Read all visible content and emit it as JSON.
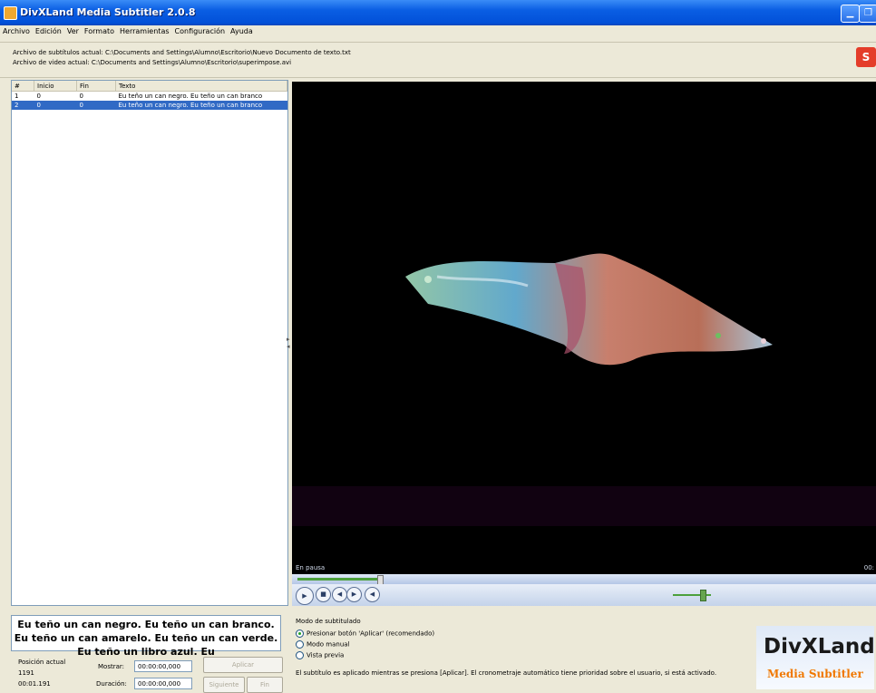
{
  "window": {
    "title": "DivXLand Media Subtitler 2.0.8"
  },
  "menu": [
    "Archivo",
    "Edición",
    "Ver",
    "Formato",
    "Herramientas",
    "Configuración",
    "Ayuda"
  ],
  "info": {
    "subtitle_file": "Archivo de subtítulos actual: C:\\Documents and Settings\\Alumno\\Escritorio\\Nuevo Documento de texto.txt",
    "video_file": "Archivo de video actual:  C:\\Documents and Settings\\Alumno\\Escritorio\\superimpose.avi",
    "logo_letter": "S"
  },
  "subtitle_list": {
    "headers": [
      "#",
      "Inicio",
      "Fin",
      "Texto"
    ],
    "rows": [
      {
        "num": "1",
        "start": "0",
        "end": "0",
        "text": "Eu teño un can negro. Eu teño un can branco"
      },
      {
        "num": "2",
        "start": "0",
        "end": "0",
        "text": "Eu teño un can negro. Eu teño un can branco"
      }
    ]
  },
  "player": {
    "status": "En pausa",
    "time": "00:",
    "seek_progress": 0.15,
    "volume_level": 0.6
  },
  "current_subtitle": "Eu teño un can negro. Eu teño un can branco. Eu teño un can amarelo. Eu teño un can verde. Eu teño un libro azul. Eu",
  "position": {
    "label": "Posición actual",
    "frame": "1191",
    "time": "00:01.191",
    "show_label": "Mostrar:",
    "show_value": "00:00:00,000",
    "duration_label": "Duración:",
    "duration_value": "00:00:00,000"
  },
  "buttons": {
    "apply": "Aplicar",
    "next": "Siguiente",
    "end": "Fin"
  },
  "mode": {
    "title": "Modo de subtitulado",
    "options": [
      "Presionar botón 'Aplicar' (recomendado)",
      "Modo manual",
      "Vista previa"
    ],
    "selected": 0,
    "note": "El subtítulo es aplicado mientras se presiona [Aplicar]. El cronometraje automático tiene prioridad sobre el usuario, si está activado."
  },
  "brand": {
    "line1": "DivXLand",
    "line2": "Media Subtitler"
  },
  "colors": {
    "titlebar": "#0a5ee3",
    "selection": "#316ac5",
    "brand_orange": "#f07800",
    "progress_green": "#4ca03c"
  }
}
